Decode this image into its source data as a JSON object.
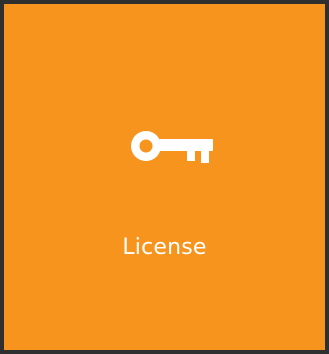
{
  "tile": {
    "label": "License",
    "icon": "key-icon",
    "background_color": "#f7941e",
    "text_color": "#ffffff",
    "frame_color": "#2f2f2f"
  }
}
